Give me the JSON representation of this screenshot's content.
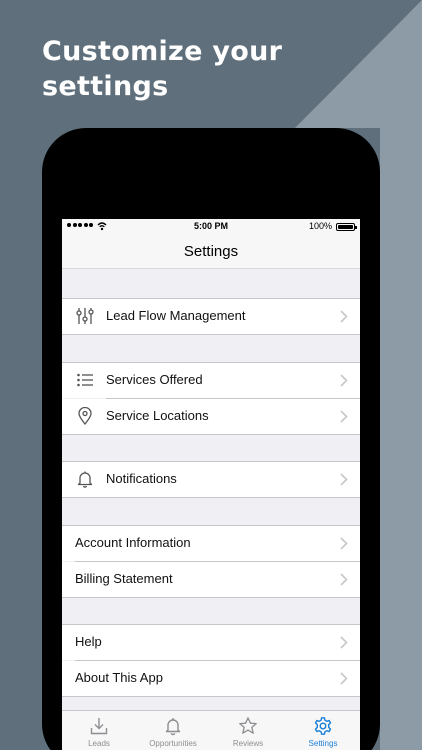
{
  "headline": {
    "line1": "Customize your",
    "line2": "settings"
  },
  "status_bar": {
    "time": "5:00 PM",
    "battery": "100%"
  },
  "nav": {
    "title": "Settings"
  },
  "rows": {
    "lead_flow": {
      "label": "Lead Flow Management",
      "icon": "sliders-icon"
    },
    "services_offered": {
      "label": "Services Offered",
      "icon": "list-icon"
    },
    "service_locations": {
      "label": "Service Locations",
      "icon": "location-pin-icon"
    },
    "notifications": {
      "label": "Notifications",
      "icon": "bell-icon"
    },
    "account_information": {
      "label": "Account Information"
    },
    "billing_statement": {
      "label": "Billing Statement"
    },
    "help": {
      "label": "Help"
    },
    "about": {
      "label": "About This App"
    }
  },
  "tabs": [
    {
      "label": "Leads",
      "icon": "download-tray-icon"
    },
    {
      "label": "Opportunities",
      "icon": "bell-icon"
    },
    {
      "label": "Reviews",
      "icon": "star-icon"
    },
    {
      "label": "Settings",
      "icon": "gear-icon",
      "active": true
    }
  ],
  "colors": {
    "accent": "#1a7fd8",
    "background": "#5f707c",
    "diagonal": "#8c9ba6"
  }
}
